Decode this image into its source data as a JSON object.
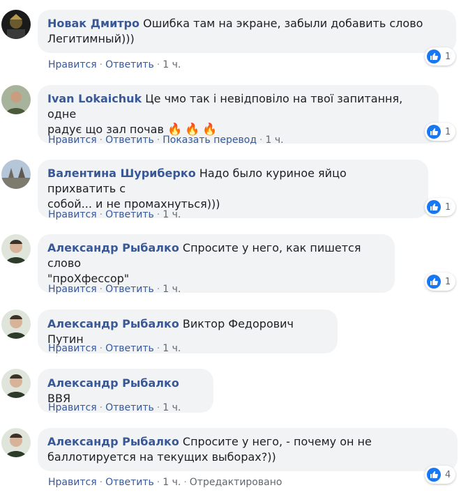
{
  "colors": {
    "author": "#385898",
    "bubble": "#f2f3f5",
    "like": "#1877f2",
    "fire": "#f5520a"
  },
  "comments": [
    {
      "author": "Новак Дмитро",
      "line1": "Ошибка там на экране, забыли добавить слово",
      "line2": "Легитимный)))",
      "like_label": "Нравится",
      "reply_label": "Ответить",
      "time": "1 ч.",
      "reactions": "1"
    },
    {
      "author": "Ivan Lokaichuk",
      "line1": "Це чмо так і невідповіло на твої запитання, одне",
      "line2": "радує що зал почав",
      "like_label": "Нравится",
      "reply_label": "Ответить",
      "translate_label": "Показать перевод",
      "time": "1 ч.",
      "reactions": "1"
    },
    {
      "author": "Валентина Шуриберко",
      "line1": "Надо было куриное яйцо прихватить с",
      "line2": "собой... и не промахнуться)))",
      "like_label": "Нравится",
      "reply_label": "Ответить",
      "time": "1 ч.",
      "reactions": "1"
    },
    {
      "author": "Александр Рыбалко",
      "line1": "Спросите у него, как пишется слово",
      "line2": "\"проХфессор\"",
      "like_label": "Нравится",
      "reply_label": "Ответить",
      "time": "1 ч.",
      "reactions": "1"
    },
    {
      "author": "Александр Рыбалко",
      "line1": "Виктор Федорович Путин",
      "like_label": "Нравится",
      "reply_label": "Ответить",
      "time": "1 ч."
    },
    {
      "author": "Александр Рыбалко",
      "line1": "ВВЯ",
      "like_label": "Нравится",
      "reply_label": "Ответить",
      "time": "1 ч."
    },
    {
      "author": "Александр Рыбалко",
      "line1": "Спросите у него, - почему он не",
      "line2": "баллотируется на текущих выборах?))",
      "like_label": "Нравится",
      "reply_label": "Ответить",
      "time": "1 ч.",
      "edited_label": "Отредактировано",
      "reactions": "4"
    }
  ]
}
